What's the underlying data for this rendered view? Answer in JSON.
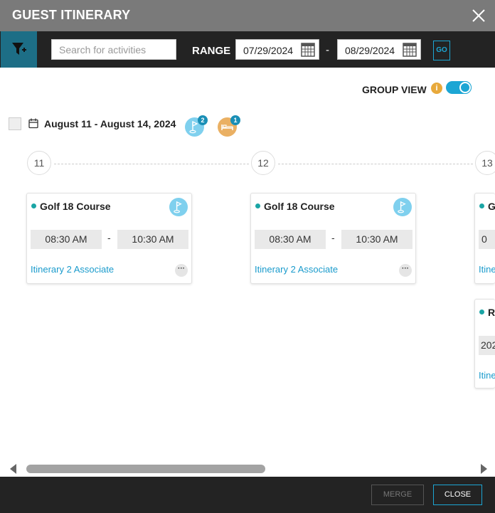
{
  "dialog": {
    "title": "GUEST ITINERARY",
    "close_icon": "close-icon"
  },
  "toolbar": {
    "filter_icon": "filter-add-icon",
    "search_placeholder": "Search for activities",
    "range_label": "RANGE",
    "start_date": "07/29/2024",
    "end_date": "08/29/2024",
    "date_separator": "-",
    "go_label": "GO"
  },
  "group_view": {
    "label": "GROUP VIEW",
    "info_icon": "i",
    "enabled": true
  },
  "group": {
    "date_range": "August 11 - August 14, 2024",
    "badges": [
      {
        "icon": "golf-flag-icon",
        "count": "2",
        "color": "#7fd0ee"
      },
      {
        "icon": "bed-icon",
        "count": "1",
        "color": "#eab063"
      }
    ]
  },
  "days": [
    {
      "label": "11"
    },
    {
      "label": "12"
    },
    {
      "label": "13"
    }
  ],
  "cards": [
    {
      "title": "Golf 18 Course",
      "start": "08:30 AM",
      "end": "10:30 AM",
      "separator": "-",
      "associate": "Itinerary 2 Associate",
      "more": "···"
    },
    {
      "title": "Golf 18 Course",
      "start": "08:30 AM",
      "end": "10:30 AM",
      "separator": "-",
      "associate": "Itinerary 2 Associate",
      "more": "···"
    },
    {
      "title": "G",
      "start": "0",
      "associate": "Itine"
    },
    {
      "title": "R",
      "start": "202",
      "associate": "Itine"
    }
  ],
  "footer": {
    "merge_label": "MERGE",
    "close_label": "CLOSE"
  },
  "colors": {
    "accent": "#1ca6d4",
    "toolbar": "#232323",
    "titlebar": "#7a7a7a",
    "filter_bg": "#1d6e86",
    "info": "#e8a93b"
  }
}
